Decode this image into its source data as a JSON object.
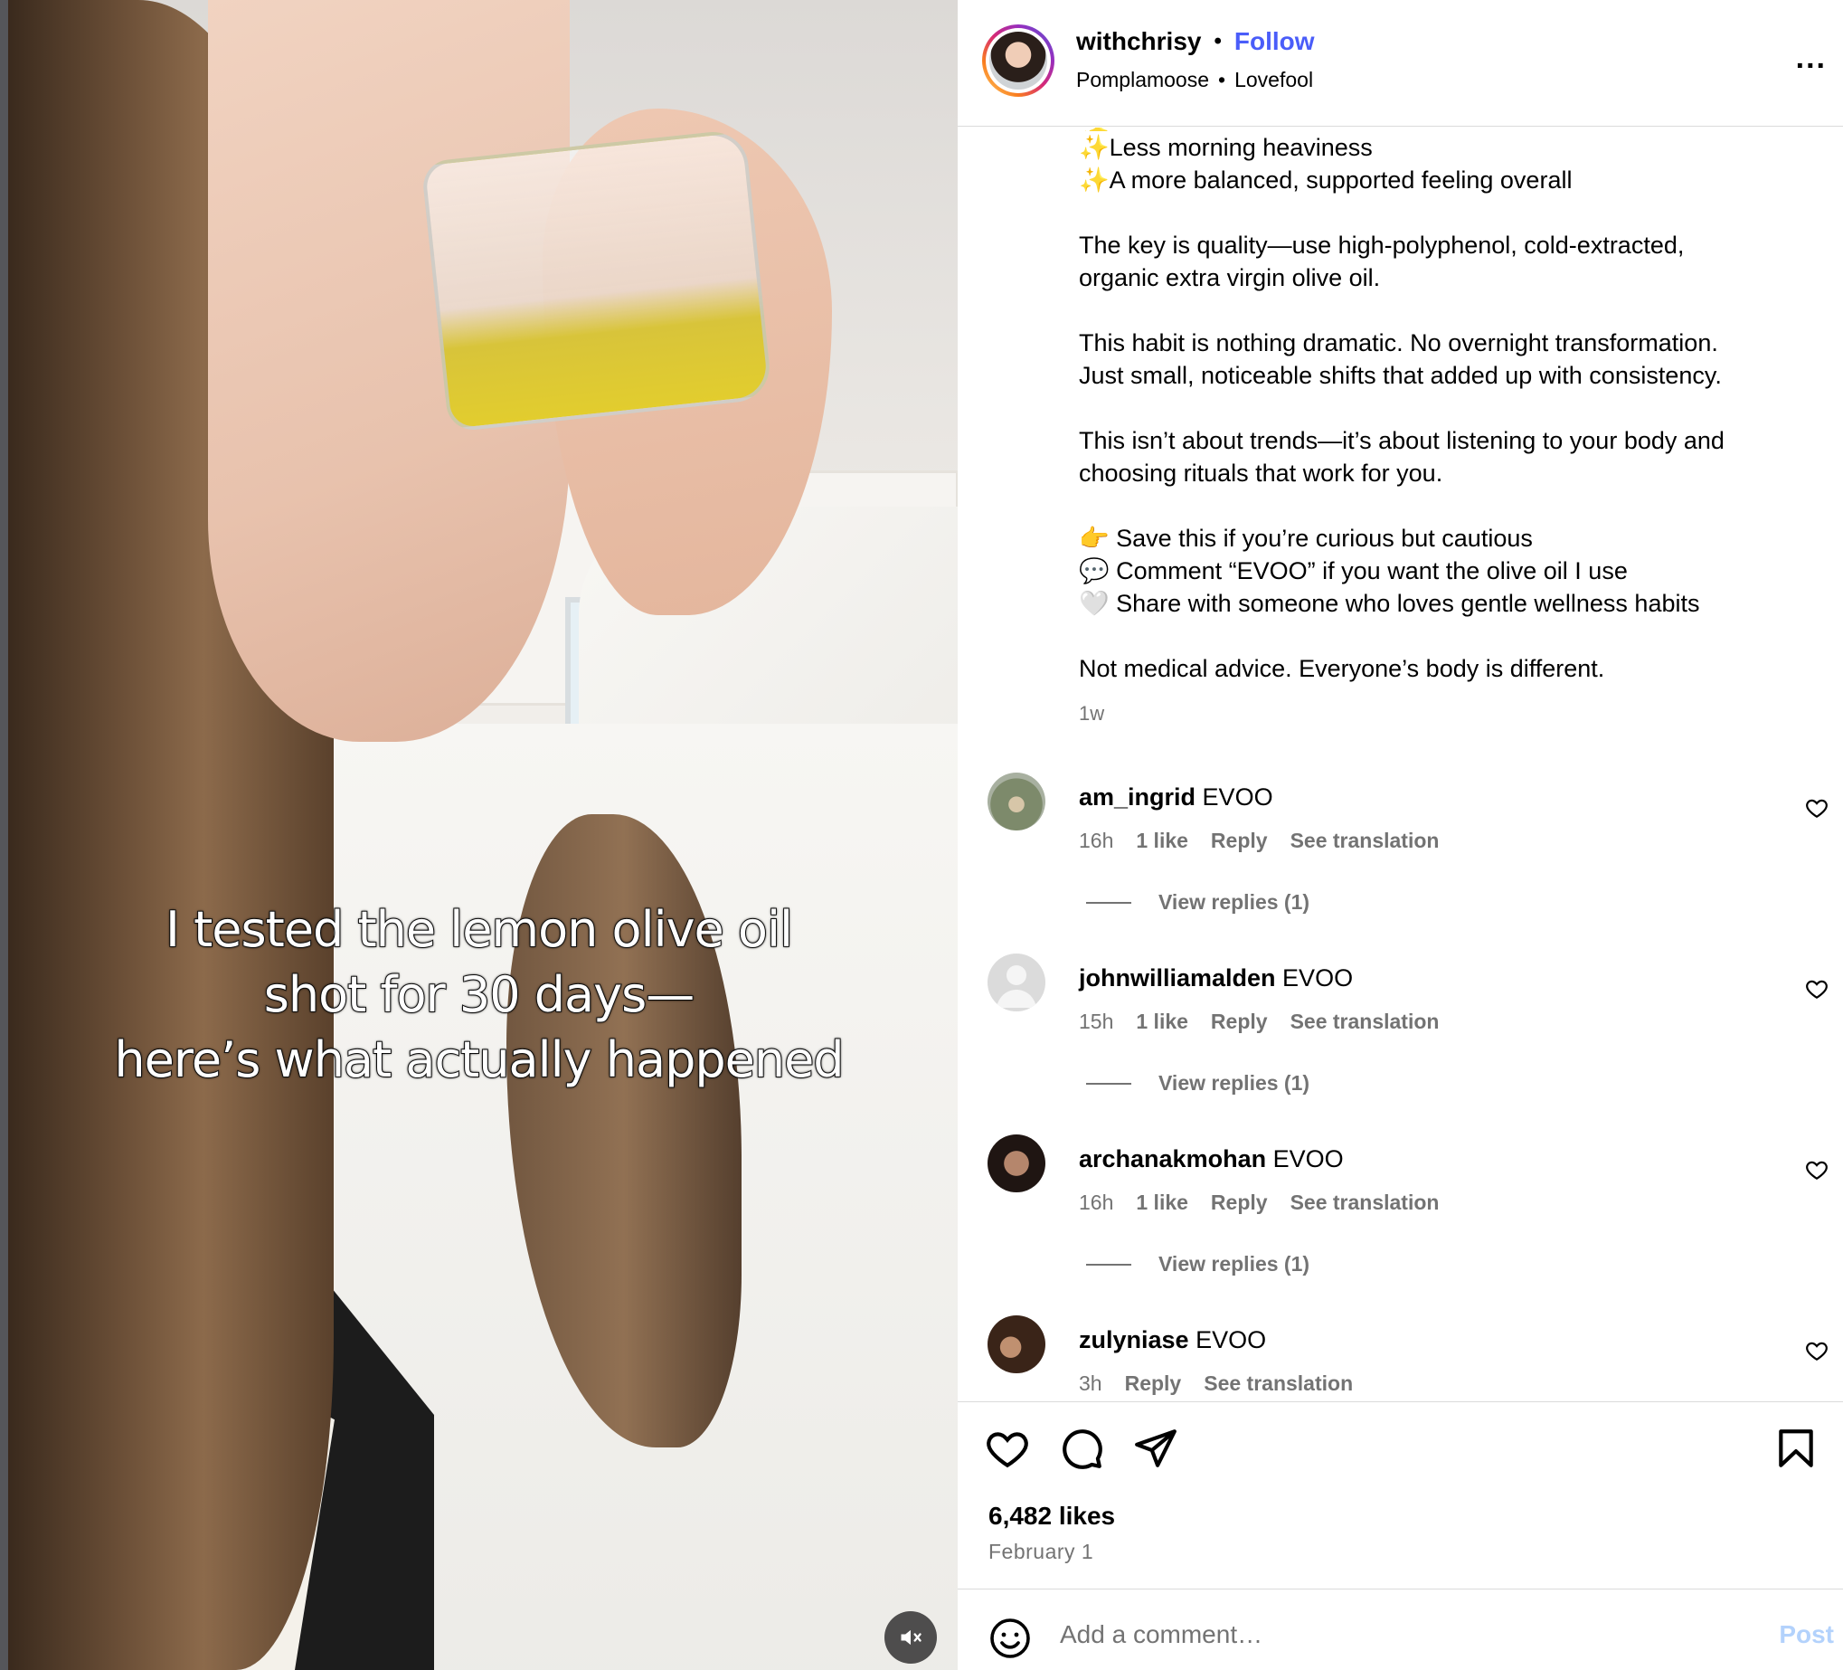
{
  "post": {
    "caption_overlay": [
      "I tested the lemon olive oil",
      "shot for 30 days—",
      "here’s what actually happened"
    ],
    "mute_icon": "speaker-muted-icon"
  },
  "header": {
    "username": "withchrisy",
    "separator": "•",
    "follow_label": "Follow",
    "audio_artist": "Pomplamoose",
    "audio_title": "Lovefool",
    "more_icon": "more-options-icon",
    "more_label": "..."
  },
  "caption": {
    "lines": [
      "Less morning heaviness",
      "A more balanced, supported feeling overall",
      "",
      "The key is quality—use high-polyphenol, cold-extracted,",
      "organic extra virgin olive oil.",
      "",
      "This habit is nothing dramatic. No overnight transformation.",
      "Just small, noticeable shifts that added up with consistency.",
      "",
      "This isn’t about trends—it’s about listening to your body and",
      "choosing rituals that work for you.",
      "",
      "👉 Save this if you’re curious but cautious",
      "💬 Comment “EVOO” if you want the olive oil I use",
      "🤍 Share with someone who loves gentle wellness habits",
      "",
      "Not medical advice. Everyone’s body is different."
    ],
    "sparkle": "✨",
    "time_ago": "1w"
  },
  "comments": [
    {
      "username": "am_ingrid",
      "text": "EVOO",
      "time": "16h",
      "likes": "1 like",
      "reply": "Reply",
      "translate": "See translation",
      "view_replies": "View replies (1)",
      "avatar_color": "#9aa08a"
    },
    {
      "username": "johnwilliamalden",
      "text": "EVOO",
      "time": "15h",
      "likes": "1 like",
      "reply": "Reply",
      "translate": "See translation",
      "view_replies": "View replies (1)",
      "avatar_color": "#dbdbdb"
    },
    {
      "username": "archanakmohan",
      "text": "EVOO",
      "time": "16h",
      "likes": "1 like",
      "reply": "Reply",
      "translate": "See translation",
      "view_replies": "View replies (1)",
      "avatar_color": "#3a2a24"
    },
    {
      "username": "zulyniase",
      "text": "EVOO",
      "time": "3h",
      "likes": "",
      "reply": "Reply",
      "translate": "See translation",
      "view_replies": "",
      "avatar_color": "#5b3b2a"
    }
  ],
  "actions": {
    "like_icon": "heart-icon",
    "comment_icon": "comment-bubble-icon",
    "share_icon": "paper-plane-icon",
    "save_icon": "bookmark-icon",
    "likes_count": "6,482 likes",
    "date": "February 1"
  },
  "add_comment": {
    "placeholder": "Add a comment…",
    "post_label": "Post",
    "emoji_icon": "smiley-icon"
  },
  "colors": {
    "follow": "#4a5df9",
    "secondary_text": "#737373",
    "post_disabled": "#b3d2fc",
    "divider": "#dbdbdb"
  }
}
